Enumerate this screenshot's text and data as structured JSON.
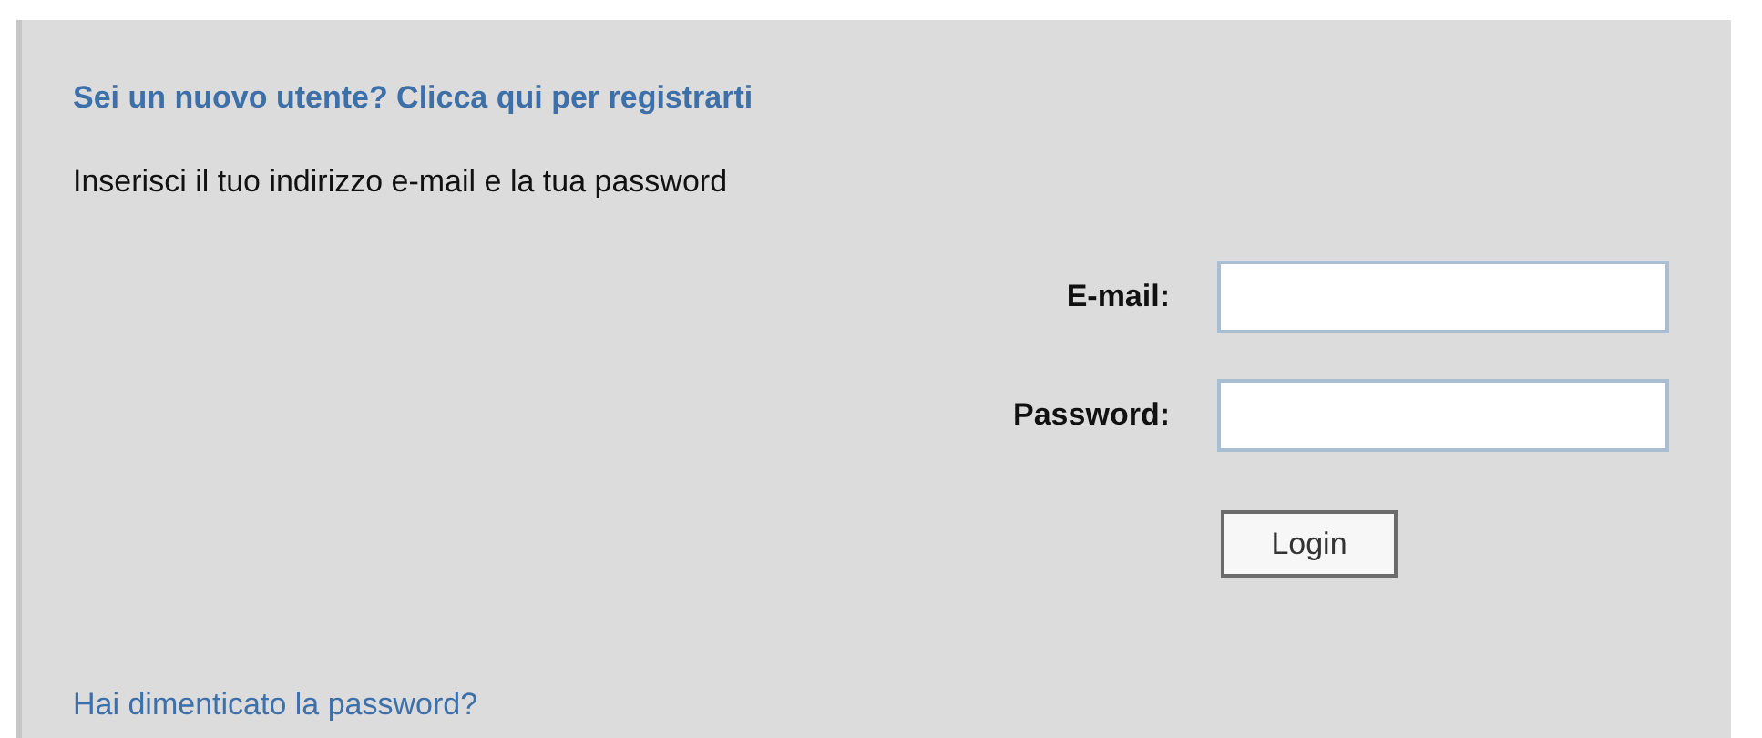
{
  "register_link": "Sei un nuovo utente? Clicca qui per registrarti",
  "instructions": "Inserisci il tuo indirizzo e-mail e la tua password",
  "fields": [
    {
      "label": "E-mail:"
    },
    {
      "label": "Password:"
    }
  ],
  "login_button": "Login",
  "forgot_link": "Hai dimenticato la password?"
}
